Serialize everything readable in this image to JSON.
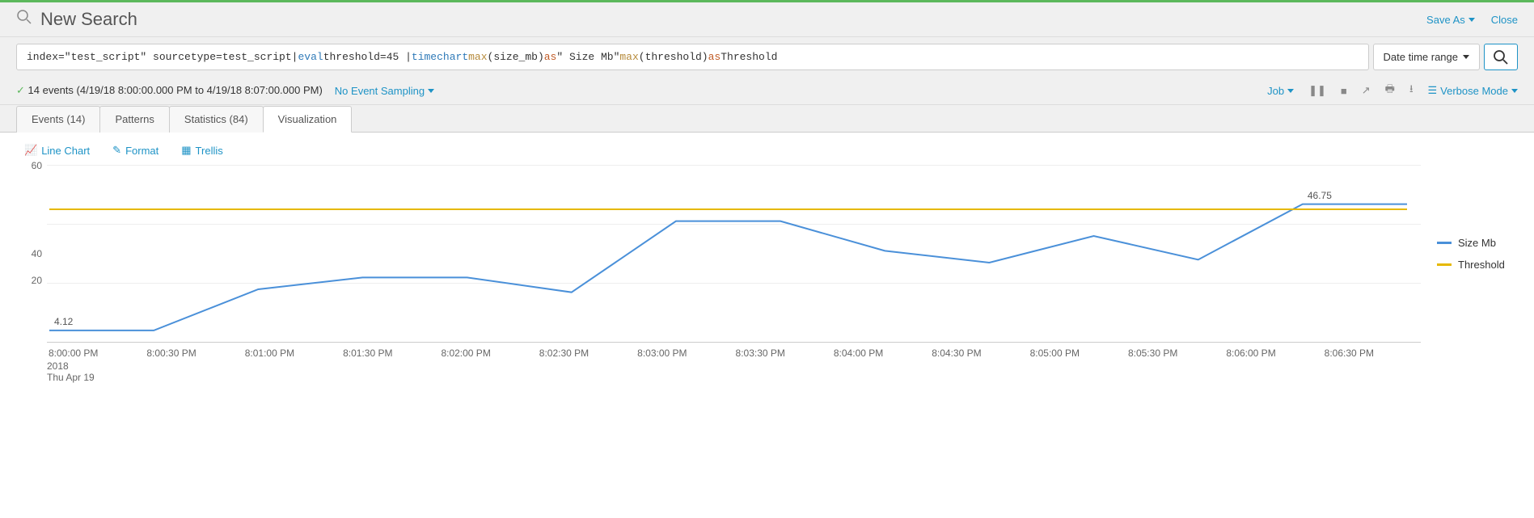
{
  "header": {
    "title": "New Search",
    "save_as": "Save As",
    "close": "Close"
  },
  "search": {
    "spl": {
      "p1": "index=\"test_script\" sourcetype=test_script|",
      "p2": "eval",
      "p3": " threshold=45 | ",
      "p4": "timechart",
      "p5": " ",
      "p6": "max",
      "p7": "(size_mb) ",
      "p8": "as",
      "p9": " \" Size Mb\" ",
      "p10": "max",
      "p11": "(threshold) ",
      "p12": "as",
      "p13": " Threshold"
    },
    "time_label": "Date time range"
  },
  "status": {
    "events": "14 events (4/19/18 8:00:00.000 PM to 4/19/18 8:07:00.000 PM)",
    "sampling": "No Event Sampling",
    "job": "Job",
    "mode": "Verbose Mode"
  },
  "tabs": {
    "events": "Events (14)",
    "patterns": "Patterns",
    "statistics": "Statistics (84)",
    "visualization": "Visualization"
  },
  "vis_toolbar": {
    "chart_type": "Line Chart",
    "format": "Format",
    "trellis": "Trellis"
  },
  "legend": {
    "series1": "Size Mb",
    "series2": "Threshold",
    "color1": "#4a90d9",
    "color2": "#e6b800"
  },
  "y_ticks": [
    "60",
    "40",
    "20"
  ],
  "x_ticks": [
    "8:00:00 PM",
    "8:00:30 PM",
    "8:01:00 PM",
    "8:01:30 PM",
    "8:02:00 PM",
    "8:02:30 PM",
    "8:03:00 PM",
    "8:03:30 PM",
    "8:04:00 PM",
    "8:04:30 PM",
    "8:05:00 PM",
    "8:05:30 PM",
    "8:06:00 PM",
    "8:06:30 PM"
  ],
  "x_sub": {
    "year": "2018",
    "day": "Thu Apr 19"
  },
  "labels": {
    "first": "4.12",
    "last": "46.75"
  },
  "chart_data": {
    "type": "line",
    "title": "",
    "xlabel": "",
    "ylabel": "",
    "ylim": [
      0,
      60
    ],
    "categories": [
      "8:00:00 PM",
      "8:00:30 PM",
      "8:01:00 PM",
      "8:01:30 PM",
      "8:02:00 PM",
      "8:02:30 PM",
      "8:03:00 PM",
      "8:03:30 PM",
      "8:04:00 PM",
      "8:04:30 PM",
      "8:05:00 PM",
      "8:05:30 PM",
      "8:06:00 PM",
      "8:06:30 PM"
    ],
    "series": [
      {
        "name": "Size Mb",
        "color": "#4a90d9",
        "values": [
          4.12,
          4.12,
          18,
          22,
          22,
          17,
          41,
          41,
          31,
          27,
          36,
          28,
          46.75,
          46.75
        ]
      },
      {
        "name": "Threshold",
        "color": "#e6b800",
        "values": [
          45,
          45,
          45,
          45,
          45,
          45,
          45,
          45,
          45,
          45,
          45,
          45,
          45,
          45
        ]
      }
    ],
    "annotations": [
      {
        "index": 0,
        "series": "Size Mb",
        "text": "4.12"
      },
      {
        "index": 12,
        "series": "Size Mb",
        "text": "46.75"
      }
    ]
  }
}
